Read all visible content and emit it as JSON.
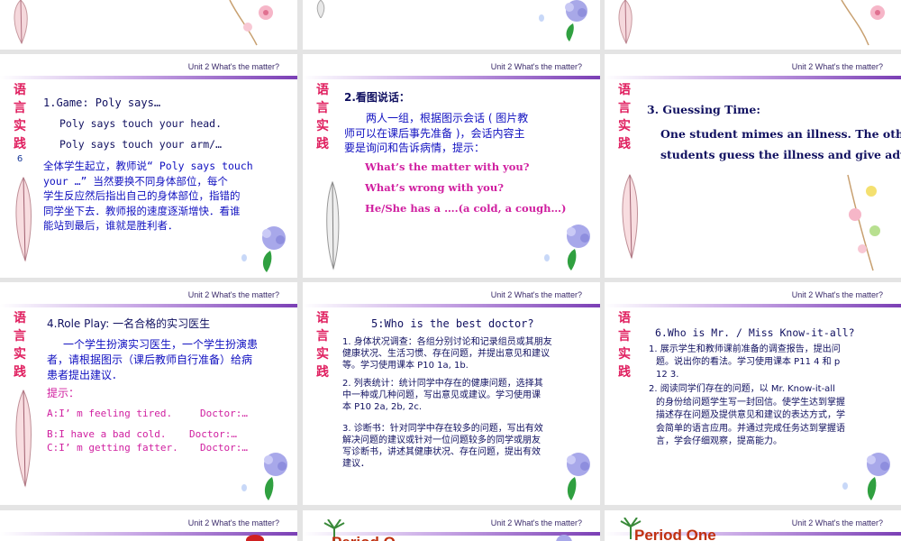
{
  "header": "Unit 2  What's the matter?",
  "side_label": [
    "语",
    "言",
    "实",
    "践"
  ],
  "slides": {
    "s4": {
      "num": "6",
      "title": "1.Game: Poly says…",
      "line1": "Poly says touch your head.",
      "line2": "Poly says touch your arm/…",
      "desc": [
        "全体学生起立，教师说“ Poly says touch",
        "your …”  当然要换不同身体部位，每个",
        "学生反应然后指出自己的身体部位，指错的",
        "同学坐下去．教师报的速度逐渐增快．看谁",
        "能站到最后，谁就是胜利者．"
      ]
    },
    "s5": {
      "title": "2.看图说话：",
      "desc": [
        "两人一组，根据图示会话 ( 图片教",
        "师可以在课后事先准备 )，会话内容主",
        "要是询问和告诉病情，提示："
      ],
      "q1": "What’s the matter with you?",
      "q2": "What’s wrong with you?",
      "q3": "He/She has a ….(a cold, a cough…)"
    },
    "s6": {
      "title": "3. Guessing Time:",
      "desc": [
        "One student mimes an illness. The other",
        "students guess the illness and give advice."
      ]
    },
    "s7": {
      "title": "4.Role Play: 一名合格的实习医生",
      "desc": [
        "一个学生扮演实习医生，一个学生扮演患",
        "者，请根据图示（课后教师自行准备）给病",
        "患者提出建议．"
      ],
      "hint": "提示：",
      "a": "A:I’ m feeling tired.",
      "a_doc": "Doctor:…",
      "b": "B:I have a bad cold.",
      "b_doc": "Doctor:…",
      "c": "C:I’ m getting fatter.",
      "c_doc": "Doctor:…"
    },
    "s8": {
      "title": "5:Who is the best doctor?",
      "p1": [
        "1. 身体状况调查：各组分别讨论和记录组员或其朋友",
        "健康状况、生活习惯、存在问题，并提出意见和建议",
        "等。学习使用课本 P10 1a,  1b."
      ],
      "p2": [
        "2. 列表统计：统计同学中存在的健康问题，选择其",
        "中一种或几种问题，写出意见或建议。学习使用课",
        "本 P10 2a,  2b,  2c."
      ],
      "p3": [
        "3. 诊断书：针对同学中存在较多的问题，写出有效",
        "解决问题的建议或针对一位问题较多的同学或朋友",
        "写诊断书，讲述其健康状况、存在问题，提出有效",
        "建议．"
      ]
    },
    "s9": {
      "title": "6.Who is Mr. / Miss Know-it-all?",
      "p1": [
        "1. 展示学生和教师课前准备的调查报告，提出问",
        "题。说出你的看法。学习使用课本 P11 4  和  p",
        "12 3."
      ],
      "p2": [
        "2. 阅读同学们存在的问题，以 Mr. Know-it-all",
        "的身份给问题学生写一封回信。使学生达到掌握",
        "描述存在问题及提供意见和建议的表达方式，学",
        "会简单的语言应用。并通过完成任务达到掌握语",
        "言，学会仔细观察，提高能力。"
      ]
    },
    "s11": {
      "period": "Period O"
    },
    "s12": {
      "period": "Period One"
    }
  }
}
